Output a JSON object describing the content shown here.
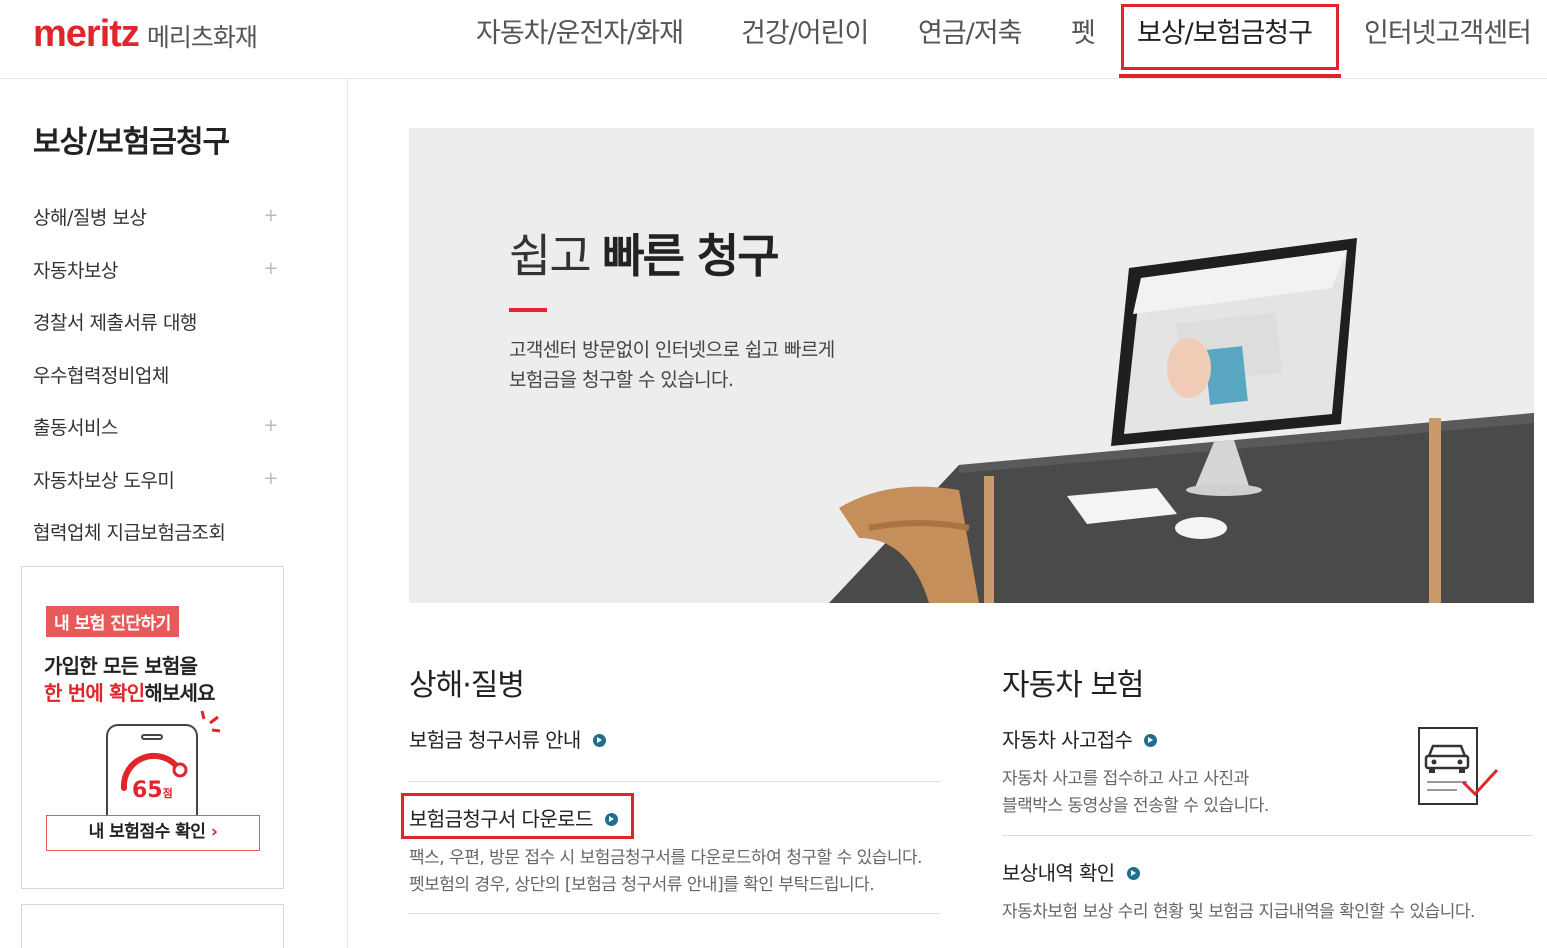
{
  "header": {
    "logo": "meritz",
    "logo_sub": "메리츠화재",
    "nav": [
      "자동차/운전자/화재",
      "건강/어린이",
      "연금/저축",
      "펫",
      "보상/보험금청구",
      "인터넷고객센터"
    ],
    "active_nav_index": 4,
    "accent_color": "#e0262b"
  },
  "sidebar": {
    "title": "보상/보험금청구",
    "items": [
      {
        "label": "상해/질병 보상",
        "expandable": true
      },
      {
        "label": "자동차보상",
        "expandable": true
      },
      {
        "label": "경찰서 제출서류 대행",
        "expandable": false
      },
      {
        "label": "우수협력정비업체",
        "expandable": false
      },
      {
        "label": "출동서비스",
        "expandable": true
      },
      {
        "label": "자동차보상 도우미",
        "expandable": true
      },
      {
        "label": "협력업체 지급보험금조회",
        "expandable": false
      }
    ],
    "plus_glyph": "+",
    "promo": {
      "badge": "내 보험 진단하기",
      "line1": "가입한 모든 보험을",
      "line2_highlight": "한 번에 확인",
      "line2_rest": "해보세요",
      "score": "65",
      "score_unit": "점",
      "button": "내 보험점수 확인",
      "button_chevron": "›"
    }
  },
  "hero": {
    "title_light": "쉽고 ",
    "title_bold": "빠른 청구",
    "desc_line1": "고객센터 방문없이 인터넷으로 쉽고 빠르게",
    "desc_line2": "보험금을 청구할 수 있습니다."
  },
  "injury": {
    "title": "상해·질병",
    "links": [
      {
        "label": "보험금 청구서류 안내"
      },
      {
        "label": "보험금청구서 다운로드",
        "highlighted": true,
        "desc_line1": "팩스, 우편, 방문 접수 시 보험금청구서를 다운로드하여 청구할 수 있습니다.",
        "desc_line2": "펫보험의 경우, 상단의 [보험금 청구서류 안내]를 확인 부탁드립니다."
      }
    ]
  },
  "car": {
    "title": "자동차 보험",
    "links": [
      {
        "label": "자동차 사고접수",
        "desc_line1": "자동차 사고를 접수하고 사고 사진과",
        "desc_line2": "블랙박스 동영상을 전송할 수 있습니다."
      },
      {
        "label": "보상내역 확인",
        "desc_line1": "자동차보험 보상 수리 현황 및 보험금 지급내역을 확인할 수 있습니다."
      }
    ],
    "icon": "car-document-check-icon"
  }
}
